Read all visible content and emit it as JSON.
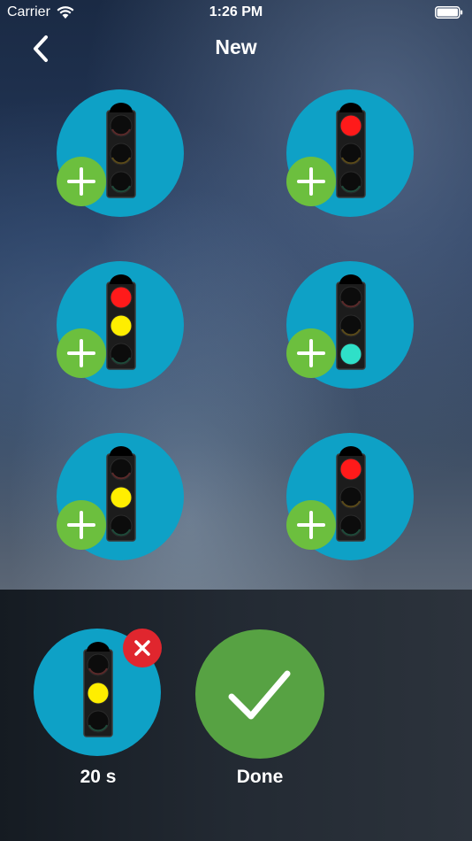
{
  "status_bar": {
    "carrier": "Carrier",
    "time": "1:26 PM"
  },
  "nav": {
    "title": "New",
    "back_icon": "chevron-left-icon"
  },
  "options": [
    {
      "name": "all-off",
      "lights": [
        "off",
        "off",
        "off"
      ]
    },
    {
      "name": "red",
      "lights": [
        "red",
        "off",
        "off"
      ]
    },
    {
      "name": "red-yellow",
      "lights": [
        "red",
        "yellow",
        "off"
      ]
    },
    {
      "name": "green",
      "lights": [
        "off",
        "off",
        "green"
      ]
    },
    {
      "name": "yellow",
      "lights": [
        "off",
        "yellow",
        "off"
      ]
    },
    {
      "name": "red-only",
      "lights": [
        "red",
        "off",
        "off"
      ]
    }
  ],
  "selected": {
    "lights": [
      "off",
      "yellow",
      "off"
    ],
    "duration_label": "20 s",
    "remove_icon": "close-icon"
  },
  "done": {
    "label": "Done",
    "icon": "checkmark-icon"
  },
  "colors": {
    "circle": "#0ea1c6",
    "add_badge": "#6cbf3e",
    "remove_badge": "#e0262e",
    "done_button": "#57a243",
    "light_red": "#ff1a1a",
    "light_yellow": "#ffee00",
    "light_green": "#2fe0c8"
  }
}
